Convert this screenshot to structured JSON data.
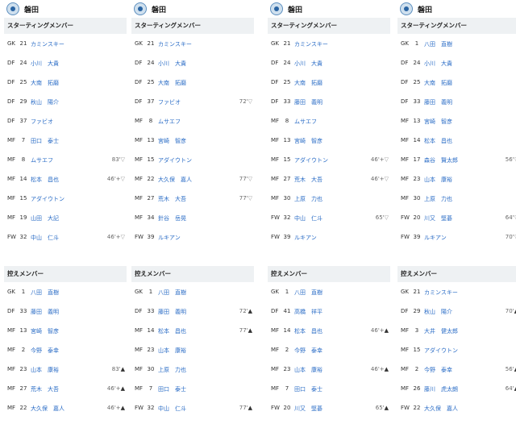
{
  "columns": [
    {
      "team": "磐田",
      "starting_title": "スターティングメンバー",
      "bench_title": "控えメンバー",
      "starting": [
        {
          "pos": "GK",
          "num": "21",
          "name": "カミンスキー",
          "sub": "",
          "dir": ""
        },
        {
          "pos": "DF",
          "num": "24",
          "name": "小川　大貴",
          "sub": "",
          "dir": ""
        },
        {
          "pos": "DF",
          "num": "25",
          "name": "大南　拓磨",
          "sub": "",
          "dir": ""
        },
        {
          "pos": "DF",
          "num": "29",
          "name": "秋山　陽介",
          "sub": "",
          "dir": ""
        },
        {
          "pos": "DF",
          "num": "37",
          "name": "ファビオ",
          "sub": "",
          "dir": ""
        },
        {
          "pos": "MF",
          "num": "7",
          "name": "田口　泰士",
          "sub": "",
          "dir": ""
        },
        {
          "pos": "MF",
          "num": "8",
          "name": "ムサエフ",
          "sub": "83'",
          "dir": "▽"
        },
        {
          "pos": "MF",
          "num": "14",
          "name": "松本　昌也",
          "sub": "46'+",
          "dir": "▽"
        },
        {
          "pos": "MF",
          "num": "15",
          "name": "アダイウトン",
          "sub": "",
          "dir": ""
        },
        {
          "pos": "MF",
          "num": "19",
          "name": "山田　大記",
          "sub": "",
          "dir": ""
        },
        {
          "pos": "FW",
          "num": "32",
          "name": "中山　仁斗",
          "sub": "46'+",
          "dir": "▽"
        }
      ],
      "bench": [
        {
          "pos": "GK",
          "num": "1",
          "name": "八田　直樹",
          "sub": "",
          "dir": ""
        },
        {
          "pos": "DF",
          "num": "33",
          "name": "藤田　義明",
          "sub": "",
          "dir": ""
        },
        {
          "pos": "MF",
          "num": "13",
          "name": "宮崎　智彦",
          "sub": "",
          "dir": ""
        },
        {
          "pos": "MF",
          "num": "2",
          "name": "今野　泰幸",
          "sub": "",
          "dir": ""
        },
        {
          "pos": "MF",
          "num": "23",
          "name": "山本　康裕",
          "sub": "83'",
          "dir": "▲"
        },
        {
          "pos": "MF",
          "num": "27",
          "name": "荒木　大吾",
          "sub": "46'+",
          "dir": "▲"
        },
        {
          "pos": "MF",
          "num": "22",
          "name": "大久保　嘉人",
          "sub": "46'+",
          "dir": "▲"
        }
      ]
    },
    {
      "team": "磐田",
      "starting_title": "スターティングメンバー",
      "bench_title": "控えメンバー",
      "starting": [
        {
          "pos": "GK",
          "num": "21",
          "name": "カミンスキー",
          "sub": "",
          "dir": ""
        },
        {
          "pos": "DF",
          "num": "24",
          "name": "小川　大貴",
          "sub": "",
          "dir": ""
        },
        {
          "pos": "DF",
          "num": "25",
          "name": "大南　拓磨",
          "sub": "",
          "dir": ""
        },
        {
          "pos": "DF",
          "num": "37",
          "name": "ファビオ",
          "sub": "72'",
          "dir": "▽"
        },
        {
          "pos": "MF",
          "num": "8",
          "name": "ムサエフ",
          "sub": "",
          "dir": ""
        },
        {
          "pos": "MF",
          "num": "13",
          "name": "宮崎　智彦",
          "sub": "",
          "dir": ""
        },
        {
          "pos": "MF",
          "num": "15",
          "name": "アダイウトン",
          "sub": "",
          "dir": ""
        },
        {
          "pos": "MF",
          "num": "22",
          "name": "大久保　嘉人",
          "sub": "77'",
          "dir": "▽"
        },
        {
          "pos": "MF",
          "num": "27",
          "name": "荒木　大吾",
          "sub": "77'",
          "dir": "▽"
        },
        {
          "pos": "MF",
          "num": "34",
          "name": "針谷　岳晃",
          "sub": "",
          "dir": ""
        },
        {
          "pos": "FW",
          "num": "39",
          "name": "ルキアン",
          "sub": "",
          "dir": ""
        }
      ],
      "bench": [
        {
          "pos": "GK",
          "num": "1",
          "name": "八田　直樹",
          "sub": "",
          "dir": ""
        },
        {
          "pos": "DF",
          "num": "33",
          "name": "藤田　義明",
          "sub": "72'",
          "dir": "▲"
        },
        {
          "pos": "MF",
          "num": "14",
          "name": "松本　昌也",
          "sub": "77'",
          "dir": "▲"
        },
        {
          "pos": "MF",
          "num": "23",
          "name": "山本　康裕",
          "sub": "",
          "dir": ""
        },
        {
          "pos": "MF",
          "num": "30",
          "name": "上原　力也",
          "sub": "",
          "dir": ""
        },
        {
          "pos": "MF",
          "num": "7",
          "name": "田口　泰士",
          "sub": "",
          "dir": ""
        },
        {
          "pos": "FW",
          "num": "32",
          "name": "中山　仁斗",
          "sub": "77'",
          "dir": "▲"
        }
      ]
    },
    {
      "team": "磐田",
      "starting_title": "スターティングメンバー",
      "bench_title": "控えメンバー",
      "starting": [
        {
          "pos": "GK",
          "num": "21",
          "name": "カミンスキー",
          "sub": "",
          "dir": ""
        },
        {
          "pos": "DF",
          "num": "24",
          "name": "小川　大貴",
          "sub": "",
          "dir": ""
        },
        {
          "pos": "DF",
          "num": "25",
          "name": "大南　拓磨",
          "sub": "",
          "dir": ""
        },
        {
          "pos": "DF",
          "num": "33",
          "name": "藤田　義明",
          "sub": "",
          "dir": ""
        },
        {
          "pos": "MF",
          "num": "8",
          "name": "ムサエフ",
          "sub": "",
          "dir": ""
        },
        {
          "pos": "MF",
          "num": "13",
          "name": "宮崎　智彦",
          "sub": "",
          "dir": ""
        },
        {
          "pos": "MF",
          "num": "15",
          "name": "アダイウトン",
          "sub": "46'+",
          "dir": "▽"
        },
        {
          "pos": "MF",
          "num": "27",
          "name": "荒木　大吾",
          "sub": "46'+",
          "dir": "▽"
        },
        {
          "pos": "MF",
          "num": "30",
          "name": "上原　力也",
          "sub": "",
          "dir": ""
        },
        {
          "pos": "FW",
          "num": "32",
          "name": "中山　仁斗",
          "sub": "65'",
          "dir": "▽"
        },
        {
          "pos": "FW",
          "num": "39",
          "name": "ルキアン",
          "sub": "",
          "dir": ""
        }
      ],
      "bench": [
        {
          "pos": "GK",
          "num": "1",
          "name": "八田　直樹",
          "sub": "",
          "dir": ""
        },
        {
          "pos": "DF",
          "num": "41",
          "name": "高橋　祥平",
          "sub": "",
          "dir": ""
        },
        {
          "pos": "MF",
          "num": "14",
          "name": "松本　昌也",
          "sub": "46'+",
          "dir": "▲"
        },
        {
          "pos": "MF",
          "num": "2",
          "name": "今野　泰幸",
          "sub": "",
          "dir": ""
        },
        {
          "pos": "MF",
          "num": "23",
          "name": "山本　康裕",
          "sub": "46'+",
          "dir": "▲"
        },
        {
          "pos": "MF",
          "num": "7",
          "name": "田口　泰士",
          "sub": "",
          "dir": ""
        },
        {
          "pos": "FW",
          "num": "20",
          "name": "川又　堅碁",
          "sub": "65'",
          "dir": "▲"
        }
      ]
    },
    {
      "team": "磐田",
      "starting_title": "スターティングメンバー",
      "bench_title": "控えメンバー",
      "starting": [
        {
          "pos": "GK",
          "num": "1",
          "name": "八田　直樹",
          "sub": "",
          "dir": ""
        },
        {
          "pos": "DF",
          "num": "24",
          "name": "小川　大貴",
          "sub": "",
          "dir": ""
        },
        {
          "pos": "DF",
          "num": "25",
          "name": "大南　拓磨",
          "sub": "",
          "dir": ""
        },
        {
          "pos": "DF",
          "num": "33",
          "name": "藤田　義明",
          "sub": "",
          "dir": ""
        },
        {
          "pos": "MF",
          "num": "13",
          "name": "宮崎　智彦",
          "sub": "",
          "dir": ""
        },
        {
          "pos": "MF",
          "num": "14",
          "name": "松本　昌也",
          "sub": "",
          "dir": ""
        },
        {
          "pos": "MF",
          "num": "17",
          "name": "森谷　賢太郎",
          "sub": "56'",
          "dir": "▽"
        },
        {
          "pos": "MF",
          "num": "23",
          "name": "山本　康裕",
          "sub": "",
          "dir": ""
        },
        {
          "pos": "MF",
          "num": "30",
          "name": "上原　力也",
          "sub": "",
          "dir": ""
        },
        {
          "pos": "FW",
          "num": "20",
          "name": "川又　堅碁",
          "sub": "64'",
          "dir": "▽"
        },
        {
          "pos": "FW",
          "num": "39",
          "name": "ルキアン",
          "sub": "70'",
          "dir": "▽"
        }
      ],
      "bench": [
        {
          "pos": "GK",
          "num": "21",
          "name": "カミンスキー",
          "sub": "",
          "dir": ""
        },
        {
          "pos": "DF",
          "num": "29",
          "name": "秋山　陽介",
          "sub": "70'",
          "dir": "▲"
        },
        {
          "pos": "MF",
          "num": "3",
          "name": "大井　健太郎",
          "sub": "",
          "dir": ""
        },
        {
          "pos": "MF",
          "num": "15",
          "name": "アダイウトン",
          "sub": "",
          "dir": ""
        },
        {
          "pos": "MF",
          "num": "2",
          "name": "今野　泰幸",
          "sub": "56'",
          "dir": "▲"
        },
        {
          "pos": "MF",
          "num": "26",
          "name": "藤川　虎太朗",
          "sub": "64'",
          "dir": "▲"
        },
        {
          "pos": "FW",
          "num": "22",
          "name": "大久保　嘉人",
          "sub": "",
          "dir": ""
        }
      ]
    }
  ]
}
